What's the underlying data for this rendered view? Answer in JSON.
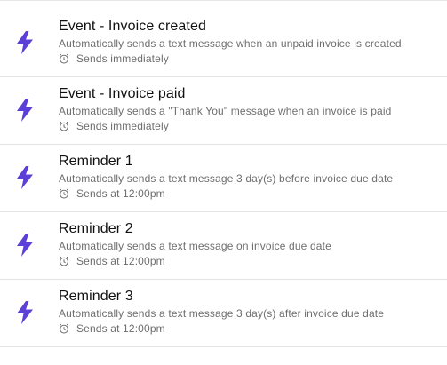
{
  "colors": {
    "accent": "#5b3fd6",
    "title": "#111111",
    "muted": "#6e6e6e",
    "divider": "#e3e3e3"
  },
  "automations": [
    {
      "icon": "lightning-bolt-icon",
      "title": "Event - Invoice created",
      "description": "Automatically sends a text message when an unpaid invoice is created",
      "timing_icon": "alarm-clock-icon",
      "timing": "Sends immediately"
    },
    {
      "icon": "lightning-bolt-icon",
      "title": "Event - Invoice paid",
      "description": "Automatically sends a \"Thank You\" message when an invoice is paid",
      "timing_icon": "alarm-clock-icon",
      "timing": "Sends immediately"
    },
    {
      "icon": "lightning-bolt-icon",
      "title": "Reminder 1",
      "description": "Automatically sends a text message 3 day(s) before invoice due date",
      "timing_icon": "alarm-clock-icon",
      "timing": "Sends at 12:00pm"
    },
    {
      "icon": "lightning-bolt-icon",
      "title": "Reminder 2",
      "description": "Automatically sends a text message on invoice due date",
      "timing_icon": "alarm-clock-icon",
      "timing": "Sends at 12:00pm"
    },
    {
      "icon": "lightning-bolt-icon",
      "title": "Reminder 3",
      "description": "Automatically sends a text message 3 day(s) after invoice due date",
      "timing_icon": "alarm-clock-icon",
      "timing": "Sends at 12:00pm"
    }
  ]
}
